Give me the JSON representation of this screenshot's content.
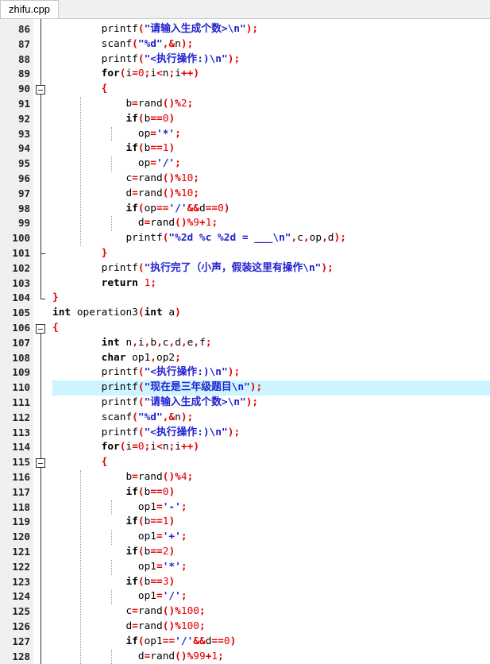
{
  "tab": {
    "title": "zhifu.cpp"
  },
  "lines": [
    {
      "n": "86",
      "t": "        printf(\"请输入生成个数>\\n\");"
    },
    {
      "n": "87",
      "t": "        scanf(\"%d\",&n);"
    },
    {
      "n": "88",
      "t": "        printf(\"<执行操作:)\\n\");"
    },
    {
      "n": "89",
      "t": "        for(i=0;i<n;i++)"
    },
    {
      "n": "90",
      "t": "        {"
    },
    {
      "n": "91",
      "t": "            b=rand()%2;"
    },
    {
      "n": "92",
      "t": "            if(b==0)"
    },
    {
      "n": "93",
      "t": "              op='*';"
    },
    {
      "n": "94",
      "t": "            if(b==1)"
    },
    {
      "n": "95",
      "t": "              op='/';"
    },
    {
      "n": "96",
      "t": "            c=rand()%10;"
    },
    {
      "n": "97",
      "t": "            d=rand()%10;"
    },
    {
      "n": "98",
      "t": "            if(op=='/'&&d==0)"
    },
    {
      "n": "99",
      "t": "              d=rand()%9+1;"
    },
    {
      "n": "100",
      "t": "            printf(\"%2d %c %2d = ___\\n\",c,op,d);"
    },
    {
      "n": "101",
      "t": "        }"
    },
    {
      "n": "102",
      "t": "        printf(\"执行完了（小声，假装这里有操作\\n\");"
    },
    {
      "n": "103",
      "t": "        return 1;"
    },
    {
      "n": "104",
      "t": "}"
    },
    {
      "n": "105",
      "t": "int operation3(int a)"
    },
    {
      "n": "106",
      "t": "{"
    },
    {
      "n": "107",
      "t": "        int n,i,b,c,d,e,f;"
    },
    {
      "n": "108",
      "t": "        char op1,op2;"
    },
    {
      "n": "109",
      "t": "        printf(\"<执行操作:)\\n\");"
    },
    {
      "n": "110",
      "t": "        printf(\"现在是三年级题目\\n\");"
    },
    {
      "n": "111",
      "t": "        printf(\"请输入生成个数>\\n\");"
    },
    {
      "n": "112",
      "t": "        scanf(\"%d\",&n);"
    },
    {
      "n": "113",
      "t": "        printf(\"<执行操作:)\\n\");"
    },
    {
      "n": "114",
      "t": "        for(i=0;i<n;i++)"
    },
    {
      "n": "115",
      "t": "        {"
    },
    {
      "n": "116",
      "t": "            b=rand()%4;"
    },
    {
      "n": "117",
      "t": "            if(b==0)"
    },
    {
      "n": "118",
      "t": "              op1='-';"
    },
    {
      "n": "119",
      "t": "            if(b==1)"
    },
    {
      "n": "120",
      "t": "              op1='+';"
    },
    {
      "n": "121",
      "t": "            if(b==2)"
    },
    {
      "n": "122",
      "t": "              op1='*';"
    },
    {
      "n": "123",
      "t": "            if(b==3)"
    },
    {
      "n": "124",
      "t": "              op1='/';"
    },
    {
      "n": "125",
      "t": "            c=rand()%100;"
    },
    {
      "n": "126",
      "t": "            d=rand()%100;"
    },
    {
      "n": "127",
      "t": "            if(op1=='/'&&d==0)"
    },
    {
      "n": "128",
      "t": "              d=rand()%99+1;"
    }
  ],
  "highlighted_line": "110",
  "fold_markers": [
    "90",
    "106",
    "115"
  ],
  "colors": {
    "highlight": "#ccf5ff",
    "string": "#1f1fcf",
    "number": "#e00000"
  }
}
